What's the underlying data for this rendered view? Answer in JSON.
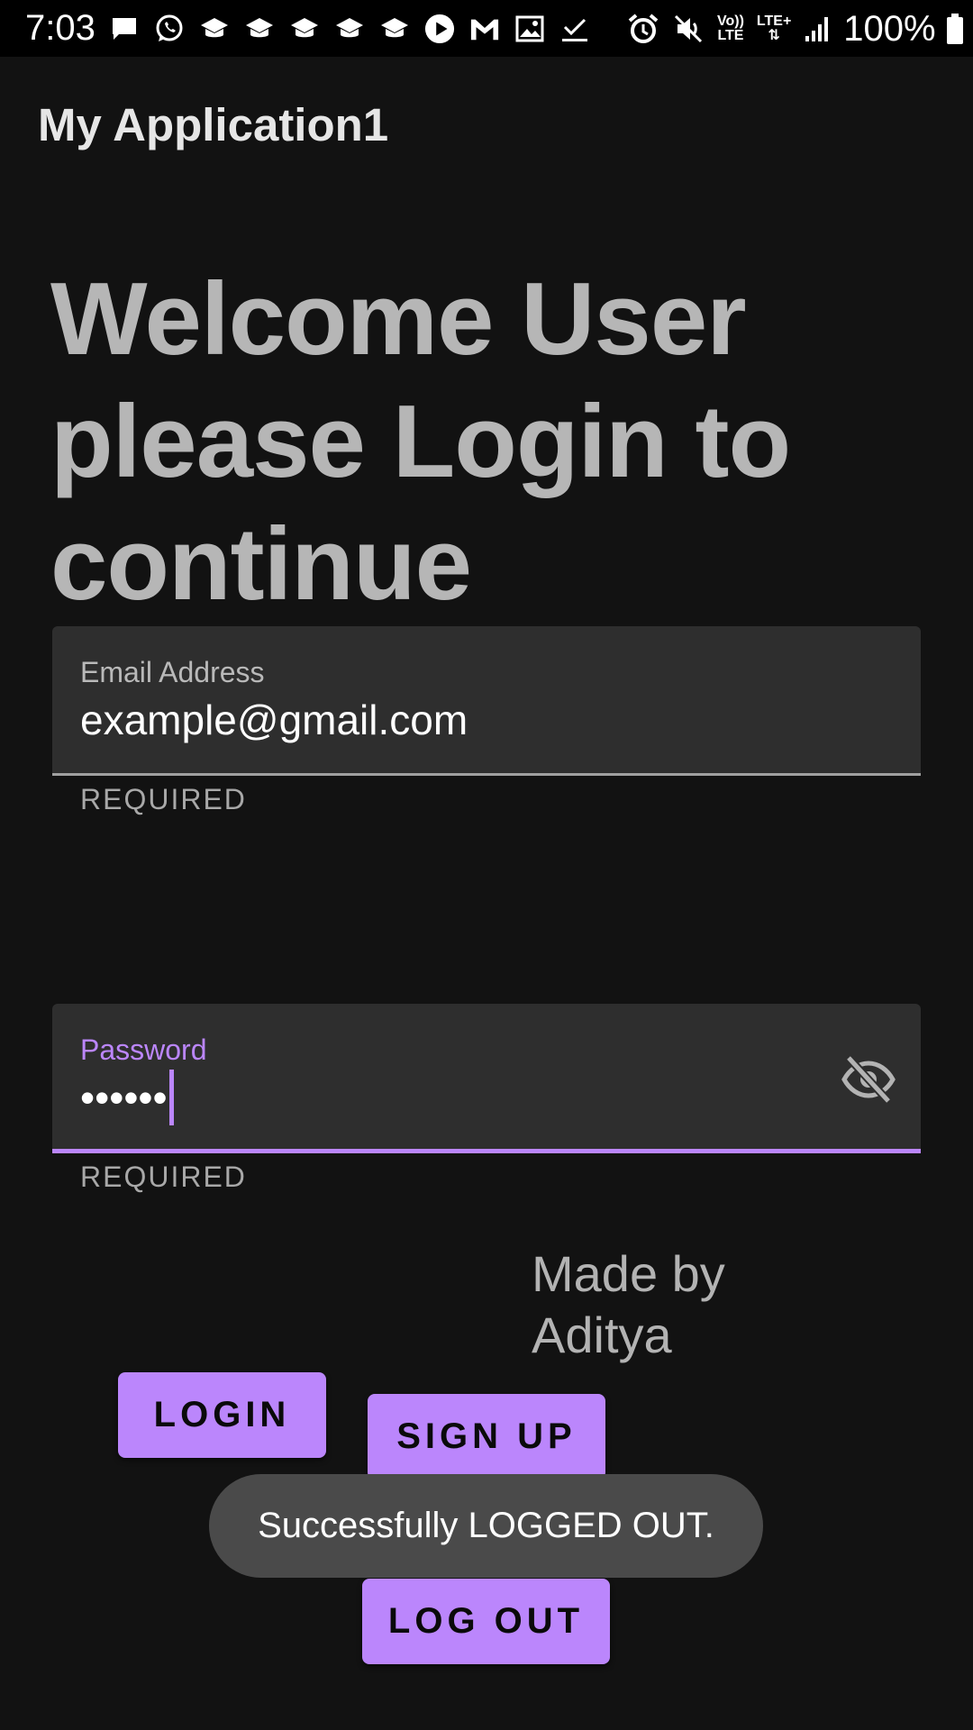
{
  "status_bar": {
    "time": "7:03",
    "battery_percent": "100%",
    "left_icons": [
      "message-icon",
      "whatsapp-icon",
      "classroom-icon",
      "classroom-icon",
      "classroom-icon",
      "classroom-icon",
      "classroom-icon",
      "play-icon",
      "gmail-icon",
      "image-icon",
      "download-done-icon"
    ],
    "right_icons": [
      "alarm-icon",
      "mute-icon",
      "volte-icon",
      "lte-plus-icon",
      "signal-icon",
      "battery-icon"
    ],
    "volte_label_top": "Vo))",
    "volte_label_bottom": "LTE",
    "lte_plus_label": "LTE+"
  },
  "app": {
    "title": "My Application1"
  },
  "welcome": {
    "heading": "Welcome User please Login to continue"
  },
  "email_field": {
    "label": "Email Address",
    "value": "example@gmail.com",
    "helper": "REQUIRED"
  },
  "password_field": {
    "label": "Password",
    "value": "••••••",
    "helper": "REQUIRED",
    "toggle_icon": "visibility-off-icon"
  },
  "credits": {
    "text": "Made by Aditya"
  },
  "buttons": {
    "login": "LOGIN",
    "sign_up": "SIGN UP",
    "log_out": "LOG OUT"
  },
  "toast": {
    "message": "Successfully LOGGED OUT."
  },
  "colors": {
    "background": "#121212",
    "accent": "#bb86fc",
    "field_background": "#2e2e2e",
    "toast_background": "#4a4a4a"
  }
}
